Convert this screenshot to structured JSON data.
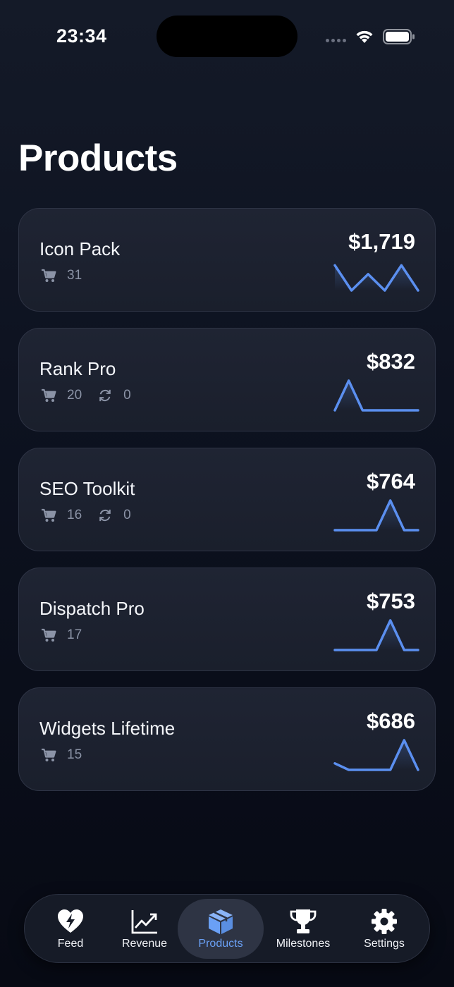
{
  "status_bar": {
    "time": "23:34"
  },
  "page": {
    "title": "Products"
  },
  "colors": {
    "accent": "#6aa0f5",
    "sparkline": "#5b8ff0",
    "card_bg": "#1d2230",
    "meta_text": "#8b93a6"
  },
  "products": [
    {
      "name": "Icon Pack",
      "price": "$1,719",
      "sales_icon": "cart-icon",
      "sales": "31",
      "renewals_icon": null,
      "renewals": null,
      "trend": [
        0.85,
        0.0,
        0.55,
        0.0,
        0.85,
        0.0
      ]
    },
    {
      "name": "Rank Pro",
      "price": "$832",
      "sales_icon": "cart-icon",
      "sales": "20",
      "renewals_icon": "refresh-icon",
      "renewals": "0",
      "trend": [
        0.0,
        1.0,
        0.0,
        0.0,
        0.0,
        0.0,
        0.0
      ]
    },
    {
      "name": "SEO Toolkit",
      "price": "$764",
      "sales_icon": "cart-icon",
      "sales": "16",
      "renewals_icon": "refresh-icon",
      "renewals": "0",
      "trend": [
        0.0,
        0.0,
        0.0,
        0.0,
        1.0,
        0.0,
        0.0
      ]
    },
    {
      "name": "Dispatch Pro",
      "price": "$753",
      "sales_icon": "cart-icon",
      "sales": "17",
      "renewals_icon": null,
      "renewals": null,
      "trend": [
        0.0,
        0.0,
        0.0,
        0.0,
        1.0,
        0.0,
        0.0
      ]
    },
    {
      "name": "Widgets Lifetime",
      "price": "$686",
      "sales_icon": "cart-icon",
      "sales": "15",
      "renewals_icon": null,
      "renewals": null,
      "trend": [
        0.22,
        0.0,
        0.0,
        0.0,
        0.0,
        1.0,
        0.0
      ]
    }
  ],
  "tab_bar": {
    "tabs": [
      {
        "label": "Feed",
        "icon": "heart-bolt-icon",
        "active": false
      },
      {
        "label": "Revenue",
        "icon": "chart-trend-icon",
        "active": false
      },
      {
        "label": "Products",
        "icon": "box-icon",
        "active": true
      },
      {
        "label": "Milestones",
        "icon": "trophy-icon",
        "active": false
      },
      {
        "label": "Settings",
        "icon": "gear-icon",
        "active": false
      }
    ]
  }
}
